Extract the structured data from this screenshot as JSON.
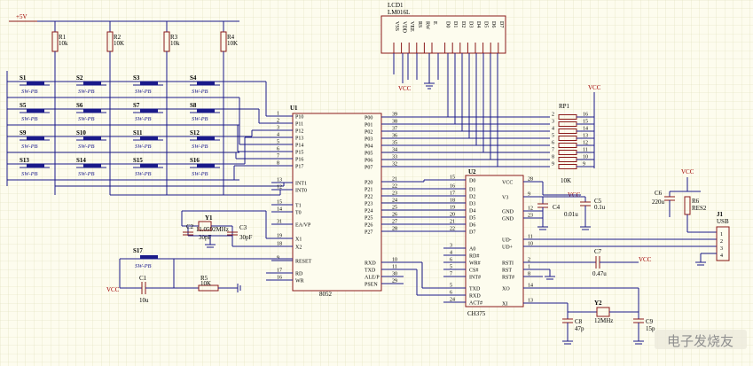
{
  "power": {
    "net": "VCC",
    "supply_label": "+5V"
  },
  "lcd": {
    "designator": "LCD1",
    "part": "LM016L",
    "pins": [
      "VSS",
      "VDD",
      "VEE",
      "RS",
      "RW",
      "E",
      "D0",
      "D1",
      "D2",
      "D3",
      "D4",
      "D5",
      "D6",
      "D7"
    ]
  },
  "resistors_top": [
    {
      "ref": "R1",
      "value": "10k"
    },
    {
      "ref": "R2",
      "value": "10K"
    },
    {
      "ref": "R3",
      "value": "10k"
    },
    {
      "ref": "R4",
      "value": "10K"
    }
  ],
  "switches": {
    "matrix": [
      "S1",
      "S2",
      "S3",
      "S4",
      "S5",
      "S6",
      "S7",
      "S8",
      "S9",
      "S10",
      "S11",
      "S12",
      "S13",
      "S14",
      "S15",
      "S16"
    ],
    "type_label": "SW-PB",
    "reset": "S17"
  },
  "mcu": {
    "designator": "U1",
    "part": "8052",
    "left_pins": [
      {
        "num": "1",
        "name": "P10"
      },
      {
        "num": "2",
        "name": "P11"
      },
      {
        "num": "3",
        "name": "P12"
      },
      {
        "num": "4",
        "name": "P13"
      },
      {
        "num": "5",
        "name": "P14"
      },
      {
        "num": "6",
        "name": "P15"
      },
      {
        "num": "7",
        "name": "P16"
      },
      {
        "num": "8",
        "name": "P17"
      },
      {
        "num": "13",
        "name": "INT1"
      },
      {
        "num": "12",
        "name": "INT0"
      },
      {
        "num": "15",
        "name": "T1"
      },
      {
        "num": "14",
        "name": "T0"
      },
      {
        "num": "31",
        "name": "EA/VP"
      },
      {
        "num": "19",
        "name": "X1"
      },
      {
        "num": "18",
        "name": "X2"
      },
      {
        "num": "9",
        "name": "RESET"
      },
      {
        "num": "17",
        "name": "RD"
      },
      {
        "num": "16",
        "name": "WR"
      }
    ],
    "right_pins": [
      {
        "num": "39",
        "name": "P00"
      },
      {
        "num": "38",
        "name": "P01"
      },
      {
        "num": "37",
        "name": "P02"
      },
      {
        "num": "36",
        "name": "P03"
      },
      {
        "num": "35",
        "name": "P04"
      },
      {
        "num": "34",
        "name": "P05"
      },
      {
        "num": "33",
        "name": "P06"
      },
      {
        "num": "32",
        "name": "P07"
      },
      {
        "num": "21",
        "name": "P20"
      },
      {
        "num": "22",
        "name": "P21"
      },
      {
        "num": "23",
        "name": "P22"
      },
      {
        "num": "24",
        "name": "P23"
      },
      {
        "num": "25",
        "name": "P24"
      },
      {
        "num": "26",
        "name": "P25"
      },
      {
        "num": "27",
        "name": "P26"
      },
      {
        "num": "28",
        "name": "P27"
      },
      {
        "num": "10",
        "name": "RXD"
      },
      {
        "num": "11",
        "name": "TXD"
      },
      {
        "num": "30",
        "name": "ALE/P"
      },
      {
        "num": "29",
        "name": "PSEN"
      }
    ]
  },
  "usb_chip": {
    "designator": "U2",
    "part": "CH375",
    "left_pins": [
      {
        "num": "15",
        "name": "D0"
      },
      {
        "num": "16",
        "name": "D1"
      },
      {
        "num": "17",
        "name": "D2"
      },
      {
        "num": "18",
        "name": "D3"
      },
      {
        "num": "19",
        "name": "D4"
      },
      {
        "num": "20",
        "name": "D5"
      },
      {
        "num": "21",
        "name": "D6"
      },
      {
        "num": "22",
        "name": "D7"
      },
      {
        "num": "3",
        "name": "A0"
      },
      {
        "num": "4",
        "name": "RD#"
      },
      {
        "num": "6",
        "name": "WR#"
      },
      {
        "num": "5",
        "name": "CS#"
      },
      {
        "num": "7",
        "name": "INT#"
      },
      {
        "num": "5",
        "name": "TXD"
      },
      {
        "num": "6",
        "name": "RXD"
      },
      {
        "num": "24",
        "name": "ACT#"
      }
    ],
    "right_pins": [
      {
        "num": "28",
        "name": "VCC"
      },
      {
        "num": "9",
        "name": "V3"
      },
      {
        "num": "12",
        "name": "GND"
      },
      {
        "num": "23",
        "name": "GND"
      },
      {
        "num": "11",
        "name": "UD-"
      },
      {
        "num": "10",
        "name": "UD+"
      },
      {
        "num": "2",
        "name": "RSTI"
      },
      {
        "num": "1",
        "name": "RST"
      },
      {
        "num": "8",
        "name": "RST#"
      },
      {
        "num": "14",
        "name": "XO"
      },
      {
        "num": "13",
        "name": "XI"
      }
    ]
  },
  "rpack": {
    "designator": "RP1",
    "value": "10K",
    "left": [
      "2",
      "3",
      "4",
      "5",
      "6",
      "7",
      "8",
      "9"
    ],
    "right": [
      "16",
      "15",
      "14",
      "13",
      "12",
      "11",
      "10",
      "9"
    ]
  },
  "crystals": [
    {
      "ref": "Y1",
      "value": "11.0592MHz"
    },
    {
      "ref": "Y2",
      "value": "12MHz"
    }
  ],
  "capacitors": [
    {
      "ref": "C1",
      "value": "10u"
    },
    {
      "ref": "C2",
      "value": "30pF"
    },
    {
      "ref": "C3",
      "value": "30pF"
    },
    {
      "ref": "C4",
      "value": "0.01u"
    },
    {
      "ref": "C5",
      "value": "0.1u"
    },
    {
      "ref": "C6",
      "value": "220u"
    },
    {
      "ref": "C7",
      "value": "0.47u"
    },
    {
      "ref": "C8",
      "value": "47p"
    },
    {
      "ref": "C9",
      "value": "15p"
    }
  ],
  "resistors_other": [
    {
      "ref": "R5",
      "value": "10K"
    },
    {
      "ref": "R6",
      "value": "RES2"
    }
  ],
  "usb_conn": {
    "ref": "J1",
    "label": "USB",
    "pins": [
      "1",
      "2",
      "3",
      "4"
    ]
  },
  "watermark": "电子发烧友"
}
